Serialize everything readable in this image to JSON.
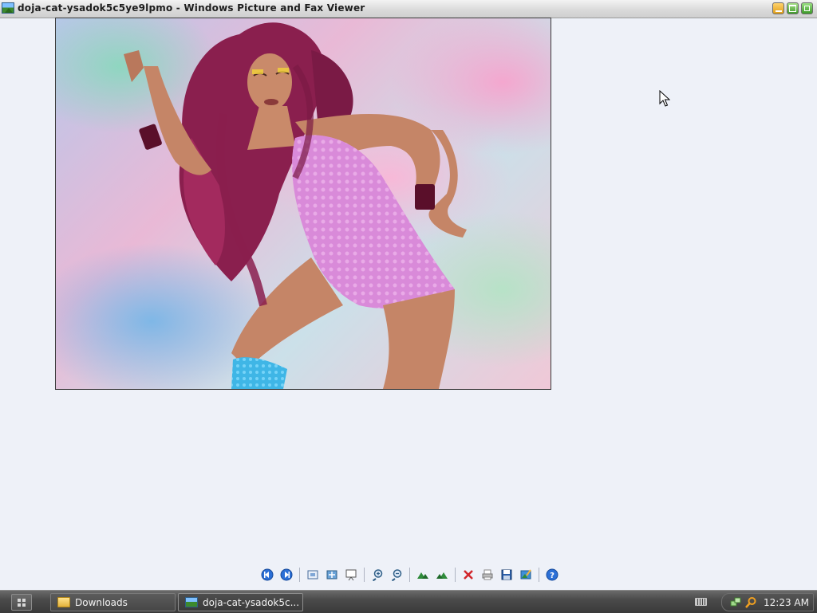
{
  "window": {
    "title": "doja-cat-ysadok5c5ye9lpmo - Windows Picture and Fax Viewer",
    "icon": "picture-viewer-icon",
    "controls": [
      "minimize-icon",
      "maximize-icon",
      "close-icon"
    ]
  },
  "viewer": {
    "image_alt": "Photo of a woman with long magenta hair in a pink textured bodysuit against a pastel swirl background",
    "background": "#eef1f8",
    "toolbar": [
      {
        "name": "previous-image-button",
        "icon": "previous-image-icon"
      },
      {
        "name": "next-image-button",
        "icon": "next-image-icon"
      },
      {
        "name": "best-fit-button",
        "icon": "best-fit-icon"
      },
      {
        "name": "actual-size-button",
        "icon": "actual-size-icon"
      },
      {
        "name": "slideshow-button",
        "icon": "slideshow-icon"
      },
      {
        "name": "zoom-in-button",
        "icon": "zoom-in-icon"
      },
      {
        "name": "zoom-out-button",
        "icon": "zoom-out-icon"
      },
      {
        "name": "rotate-clockwise-button",
        "icon": "rotate-clockwise-icon"
      },
      {
        "name": "rotate-counterclockwise-button",
        "icon": "rotate-counterclockwise-icon"
      },
      {
        "name": "delete-button",
        "icon": "delete-icon"
      },
      {
        "name": "print-button",
        "icon": "print-icon"
      },
      {
        "name": "copy-to-button",
        "icon": "save-icon"
      },
      {
        "name": "edit-button",
        "icon": "edit-icon"
      },
      {
        "name": "help-button",
        "icon": "help-icon"
      }
    ]
  },
  "taskbar": {
    "start_icon": "start-grid-icon",
    "tasks": [
      {
        "label": "Downloads",
        "icon": "folder-icon"
      },
      {
        "label": "doja-cat-ysadok5c...",
        "icon": "picture-viewer-icon"
      }
    ],
    "tray": {
      "icons": [
        "keyboard-icon",
        "network-icon",
        "search-icon"
      ],
      "clock": "12:23 AM"
    }
  }
}
